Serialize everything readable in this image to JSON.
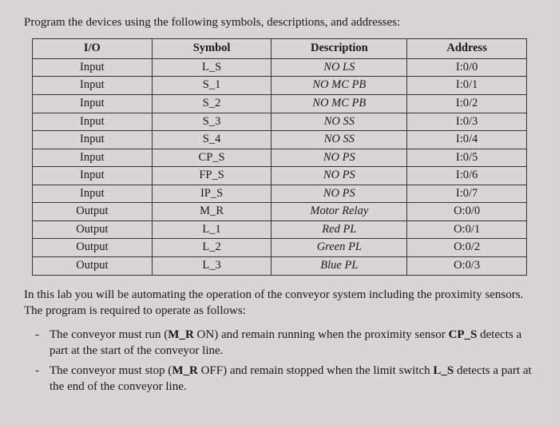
{
  "intro": "Program the devices using the following symbols, descriptions, and addresses:",
  "headers": {
    "c0": "I/O",
    "c1": "Symbol",
    "c2": "Description",
    "c3": "Address"
  },
  "rows": [
    {
      "io": "Input",
      "sym": "L_S",
      "desc": "NO LS",
      "addr": "I:0/0"
    },
    {
      "io": "Input",
      "sym": "S_1",
      "desc": "NO MC PB",
      "addr": "I:0/1"
    },
    {
      "io": "Input",
      "sym": "S_2",
      "desc": "NO MC PB",
      "addr": "I:0/2"
    },
    {
      "io": "Input",
      "sym": "S_3",
      "desc": "NO SS",
      "addr": "I:0/3"
    },
    {
      "io": "Input",
      "sym": "S_4",
      "desc": "NO SS",
      "addr": "I:0/4"
    },
    {
      "io": "Input",
      "sym": "CP_S",
      "desc": "NO PS",
      "addr": "I:0/5"
    },
    {
      "io": "Input",
      "sym": "FP_S",
      "desc": "NO PS",
      "addr": "I:0/6"
    },
    {
      "io": "Input",
      "sym": "IP_S",
      "desc": "NO PS",
      "addr": "I:0/7"
    },
    {
      "io": "Output",
      "sym": "M_R",
      "desc": "Motor Relay",
      "addr": "O:0/0"
    },
    {
      "io": "Output",
      "sym": "L_1",
      "desc": "Red PL",
      "addr": "O:0/1"
    },
    {
      "io": "Output",
      "sym": "L_2",
      "desc": "Green PL",
      "addr": "O:0/2"
    },
    {
      "io": "Output",
      "sym": "L_3",
      "desc": "Blue PL",
      "addr": "O:0/3"
    }
  ],
  "para2": "In this lab you will be automating the operation of the conveyor system including the proximity sensors. The program is required to operate as follows:",
  "bullets": {
    "b1a": "The conveyor must run (",
    "b1b": "M_R",
    "b1c": " ON) and remain running when the proximity sensor ",
    "b1d": "CP_S",
    "b1e": " detects a part at the start of the conveyor line.",
    "b2a": "The conveyor must stop (",
    "b2b": "M_R",
    "b2c": " OFF) and remain stopped when the limit switch ",
    "b2d": "L_S",
    "b2e": " detects a part at the end of the conveyor line."
  }
}
